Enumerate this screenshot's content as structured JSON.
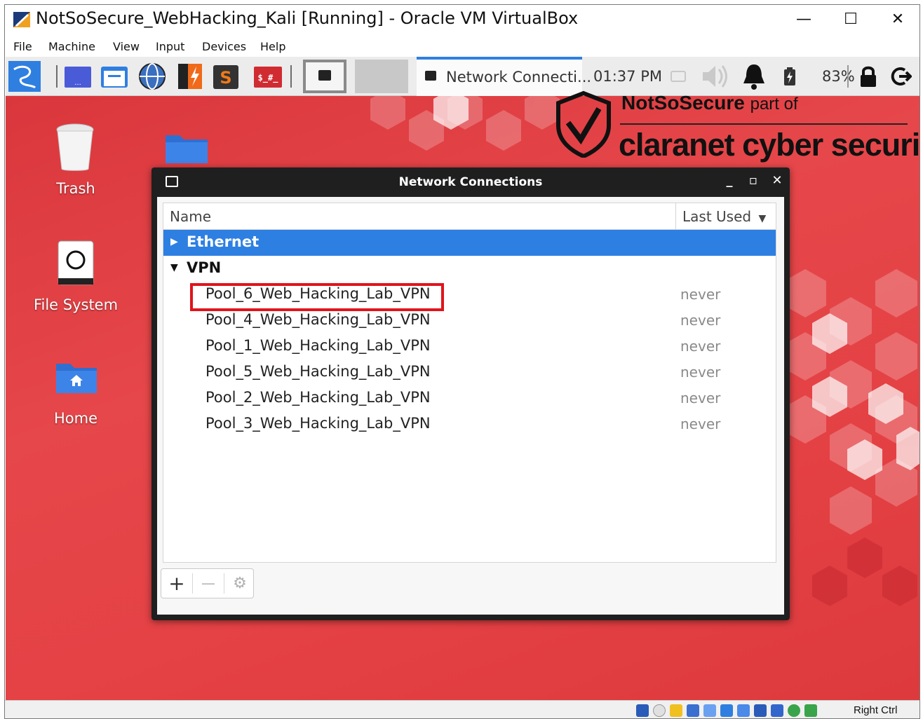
{
  "window": {
    "title": "NotSoSecure_WebHacking_Kali [Running] - Oracle VM VirtualBox",
    "controls": {
      "minimize": "—",
      "maximize": "☐",
      "close": "✕"
    }
  },
  "menu": [
    "File",
    "Machine",
    "View",
    "Input",
    "Devices",
    "Help"
  ],
  "panel": {
    "task_label": "Network Connecti...",
    "clock": "01:37 PM",
    "battery": "83%",
    "accent": "#2f7fe0"
  },
  "desktop": {
    "icons": [
      {
        "label": "Trash",
        "icon": "trash-icon"
      },
      {
        "label": "File System",
        "icon": "drive-icon"
      },
      {
        "label": "Home",
        "icon": "home-folder-icon"
      }
    ],
    "background": "#e44144"
  },
  "logo": {
    "brand": "NotSoSecure",
    "part_of": "part of",
    "company": "claranet cyber security"
  },
  "dialog": {
    "title": "Network Connections",
    "columns": {
      "name": "Name",
      "last_used": "Last Used"
    },
    "groups": [
      {
        "name": "Ethernet",
        "expanded": false,
        "selected": true,
        "connections": []
      },
      {
        "name": "VPN",
        "expanded": true,
        "selected": false,
        "connections": [
          {
            "name": "Pool_6_Web_Hacking_Lab_VPN",
            "last_used": "never",
            "highlighted": true
          },
          {
            "name": "Pool_4_Web_Hacking_Lab_VPN",
            "last_used": "never"
          },
          {
            "name": "Pool_1_Web_Hacking_Lab_VPN",
            "last_used": "never"
          },
          {
            "name": "Pool_5_Web_Hacking_Lab_VPN",
            "last_used": "never"
          },
          {
            "name": "Pool_2_Web_Hacking_Lab_VPN",
            "last_used": "never"
          },
          {
            "name": "Pool_3_Web_Hacking_Lab_VPN",
            "last_used": "never"
          }
        ]
      }
    ],
    "toolbar": {
      "add": "+",
      "remove": "—",
      "settings": "⚙"
    },
    "selection_color": "#2d7fe2",
    "highlight_color": "#e0141c"
  },
  "statusbar": {
    "host_key": "Right Ctrl"
  }
}
